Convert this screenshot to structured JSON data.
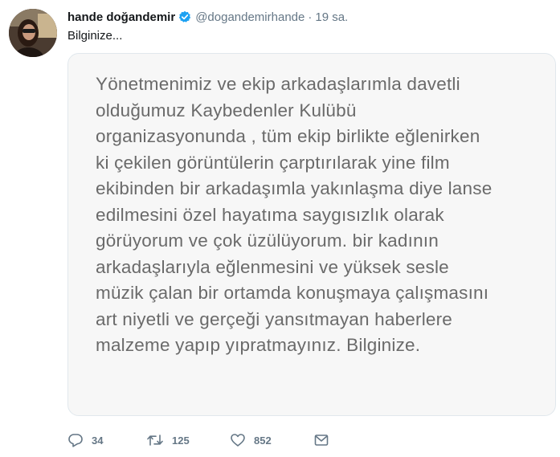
{
  "user": {
    "display_name": "hande doğandemir",
    "handle": "@dogandemirhande",
    "separator": "·",
    "time": "19 sa.",
    "verified_icon": "verified-badge-icon"
  },
  "tweet": {
    "text": "Bilginize..."
  },
  "media": {
    "lines": [
      "Yönetmenimiz ve ekip arkadaşlarımla davetli",
      "olduğumuz Kaybedenler Kulübü",
      "organizasyonunda , tüm ekip birlikte eğlenirken",
      "ki çekilen görüntülerin çarptırılarak yine film",
      "ekibinden bir arkadaşımla yakınlaşma diye lanse",
      "edilmesini özel hayatıma saygısızlık olarak",
      "görüyorum ve çok üzülüyorum. bir kadının",
      "arkadaşlarıyla eğlenmesini ve yüksek sesle",
      "müzik çalan bir ortamda konuşmaya çalışmasını",
      "art niyetli ve gerçeği yansıtmayan haberlere",
      "malzeme yapıp yıpratmayınız. Bilginize."
    ]
  },
  "actions": {
    "reply_count": "34",
    "retweet_count": "125",
    "like_count": "852"
  },
  "colors": {
    "verified": "#1da1f2",
    "secondary_text": "#657786",
    "note_text": "#6a6a6a"
  }
}
